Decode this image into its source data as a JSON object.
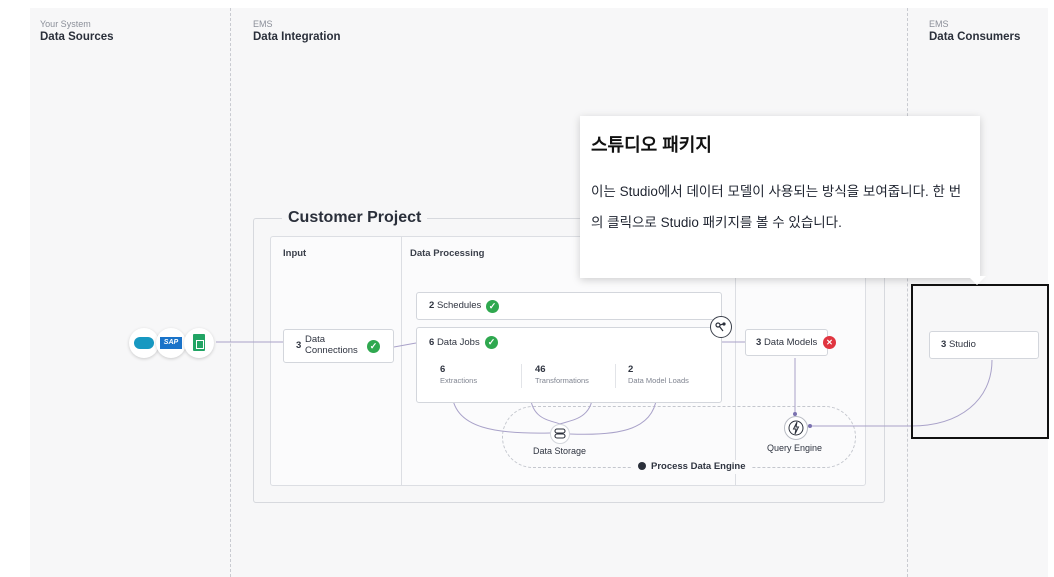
{
  "columns": {
    "sources": {
      "sub": "Your System",
      "title": "Data Sources"
    },
    "integration": {
      "sub": "EMS",
      "title": "Data Integration"
    },
    "consumers": {
      "sub": "EMS",
      "title": "Data Consumers"
    }
  },
  "project": {
    "title": "Customer Project",
    "input_label": "Input",
    "processing_label": "Data Processing"
  },
  "connections": {
    "count": "3",
    "label_line1": "Data",
    "label_line2": "Connections"
  },
  "schedules": {
    "count": "2",
    "label": "Schedules"
  },
  "jobs": {
    "count": "6",
    "label": "Data Jobs",
    "stats": [
      {
        "value": "6",
        "label": "Extractions"
      },
      {
        "value": "46",
        "label": "Transformations"
      },
      {
        "value": "2",
        "label": "Data Model Loads"
      }
    ]
  },
  "models": {
    "count": "3",
    "label": "Data Models"
  },
  "studio": {
    "count": "3",
    "label": "Studio"
  },
  "engine": {
    "storage_label": "Data Storage",
    "query_label": "Query Engine",
    "name": "Process Data Engine"
  },
  "sources_icons": [
    "salesforce-icon",
    "sap-icon",
    "google-sheets-icon"
  ],
  "sap_text": "SAP",
  "status": {
    "ok_color": "#2fa84f",
    "error_color": "#e03540"
  },
  "tooltip": {
    "title": "스튜디오 패키지",
    "body": "이는 Studio에서 데이터 모델이 사용되는 방식을 보여줍니다. 한 번의 클릭으로 Studio 패키지를 볼 수 있습니다."
  }
}
